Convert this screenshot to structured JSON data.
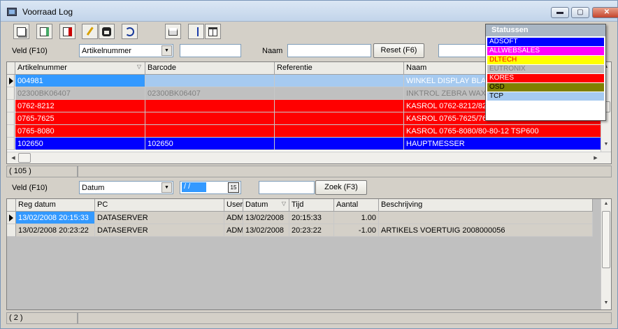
{
  "window": {
    "title": "Voorraad Log"
  },
  "titlebar": {
    "min": "▬",
    "max": "▢",
    "close": "✕"
  },
  "top_filter": {
    "field_label": "Veld (F10)",
    "field_value": "Artikelnummer",
    "field_input": "",
    "name_label": "Naam",
    "name_input": "",
    "reset_label": "Reset (F6)"
  },
  "grid1": {
    "columns": [
      "Artikelnummer",
      "Barcode",
      "Referentie",
      "Naam"
    ],
    "rows": [
      {
        "artikelnummer": "004981",
        "barcode": "",
        "referentie": "",
        "naam": "WINKEL DISPLAY BLACK",
        "bg": "#a6caf0",
        "fg": "#ffffff",
        "bg_first": "#3399ff"
      },
      {
        "artikelnummer": "02300BK06407",
        "barcode": "02300BK06407",
        "referentie": "",
        "naam": "INKTROL ZEBRA WAX 6",
        "bg": "#c0c0c0",
        "fg": "#808080",
        "bg_first": "#c0c0c0"
      },
      {
        "artikelnummer": "0762-8212",
        "barcode": "",
        "referentie": "",
        "naam": "KASROL 0762-8212/82-",
        "bg": "#ff0000",
        "fg": "#ffffff",
        "bg_first": "#ff0000"
      },
      {
        "artikelnummer": "0765-7625",
        "barcode": "",
        "referentie": "",
        "naam": "KASROL 0765-7625/76",
        "bg": "#ff0000",
        "fg": "#ffffff",
        "bg_first": "#ff0000"
      },
      {
        "artikelnummer": "0765-8080",
        "barcode": "",
        "referentie": "",
        "naam": "KASROL 0765-8080/80-80-12 TSP600",
        "bg": "#ff0000",
        "fg": "#ffffff",
        "bg_first": "#ff0000"
      },
      {
        "artikelnummer": "102650",
        "barcode": "102650",
        "referentie": "",
        "naam": "HAUPTMESSER",
        "bg": "#0000ff",
        "fg": "#ffffff",
        "bg_first": "#0000ff"
      }
    ],
    "count": "( 105 )"
  },
  "bottom_filter": {
    "field_label": "Veld (F10)",
    "field_value": "Datum",
    "date_value": "/ /",
    "date_btn": "15",
    "search_input": "",
    "search_label": "Zoek (F3)"
  },
  "grid2": {
    "columns": [
      "Reg datum",
      "PC",
      "User",
      "Datum",
      "Tijd",
      "Aantal",
      "Beschrijving"
    ],
    "rows": [
      {
        "reg_datum": "13/02/2008 20:15:33",
        "pc": "DATASERVER",
        "user": "ADM",
        "datum": "13/02/2008",
        "tijd": "20:15:33",
        "aantal": "1.00",
        "beschrijving": ""
      },
      {
        "reg_datum": "13/02/2008 20:23:22",
        "pc": "DATASERVER",
        "user": "ADM",
        "datum": "13/02/2008",
        "tijd": "20:23:22",
        "aantal": "-1.00",
        "beschrijving": "ARTIKELS VOERTUIG 2008000056"
      }
    ],
    "count": "( 2 )"
  },
  "statussen": {
    "title": "Statussen",
    "items": [
      {
        "label": "ADSOFT",
        "bg": "#0000ff",
        "fg": "#ffffff"
      },
      {
        "label": "ALLWEBSALES",
        "bg": "#ff00ff",
        "fg": "#ffffff"
      },
      {
        "label": "DLTECH",
        "bg": "#ffff00",
        "fg": "#ff0000"
      },
      {
        "label": "EUTRONIX",
        "bg": "#c0c0c0",
        "fg": "#808080"
      },
      {
        "label": "KORES",
        "bg": "#ff0000",
        "fg": "#ffffff"
      },
      {
        "label": "OSD",
        "bg": "#808000",
        "fg": "#000000"
      },
      {
        "label": "TCP",
        "bg": "#a6caf0",
        "fg": "#000000"
      }
    ]
  },
  "toolbar": {
    "icons": [
      "copy-doc-icon",
      "edit-doc-icon",
      "export-icon",
      "highlighter-icon",
      "binoculars-icon",
      "refresh-icon",
      "print-icon",
      "sort-az-icon",
      "columns-icon"
    ]
  }
}
